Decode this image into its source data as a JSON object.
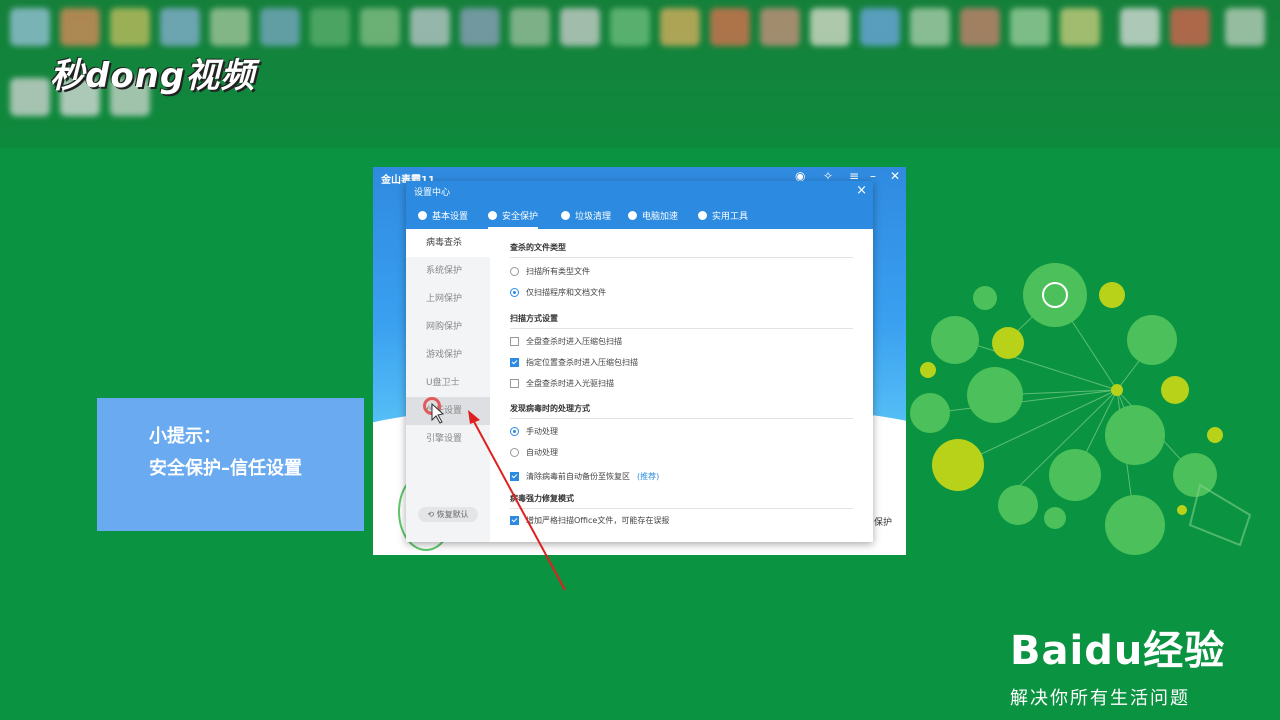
{
  "brand": {
    "logo_text": "秒dong视频"
  },
  "tip": {
    "line1": "小提示：",
    "line2": "安全保护–信任设置"
  },
  "app": {
    "title": "金山毒霸11",
    "partial_text": "保护"
  },
  "dialog": {
    "title": "设置中心",
    "close": "×",
    "tabs": [
      {
        "label": "基本设置",
        "icon": "gear-icon"
      },
      {
        "label": "安全保护",
        "icon": "shield-icon"
      },
      {
        "label": "垃圾清理",
        "icon": "broom-icon"
      },
      {
        "label": "电脑加速",
        "icon": "rocket-icon"
      },
      {
        "label": "实用工具",
        "icon": "wrench-icon"
      }
    ],
    "sidebar": [
      {
        "label": "病毒查杀"
      },
      {
        "label": "系统保护"
      },
      {
        "label": "上网保护"
      },
      {
        "label": "网购保护"
      },
      {
        "label": "游戏保护"
      },
      {
        "label": "U盘卫士"
      },
      {
        "label": "信任设置"
      },
      {
        "label": "引擎设置"
      }
    ],
    "restore_button": "恢复默认",
    "sections": {
      "file_types": {
        "title": "查杀的文件类型",
        "options": [
          "扫描所有类型文件",
          "仅扫描程序和文档文件"
        ]
      },
      "scan_mode": {
        "title": "扫描方式设置",
        "options": [
          "全盘查杀时进入压缩包扫描",
          "指定位置查杀时进入压缩包扫描",
          "全盘查杀时进入光驱扫描"
        ]
      },
      "on_virus": {
        "title": "发现病毒时的处理方式",
        "options": [
          "手动处理",
          "自动处理",
          "清除病毒前自动备份至恢复区"
        ],
        "recommend": "(推荐)"
      },
      "strong_repair": {
        "title": "病毒强力修复模式",
        "options": [
          "增加严格扫描Office文件，可能存在误报"
        ]
      }
    }
  },
  "baidu": {
    "logo": "Baidu经验",
    "slogan": "解决你所有生活问题"
  },
  "colors": {
    "background": "#0a9340",
    "accent": "#2c8be0",
    "tip_box": "#6aaaf0",
    "bubble_green": "#4cc05a",
    "bubble_yellow": "#b8d21a"
  }
}
